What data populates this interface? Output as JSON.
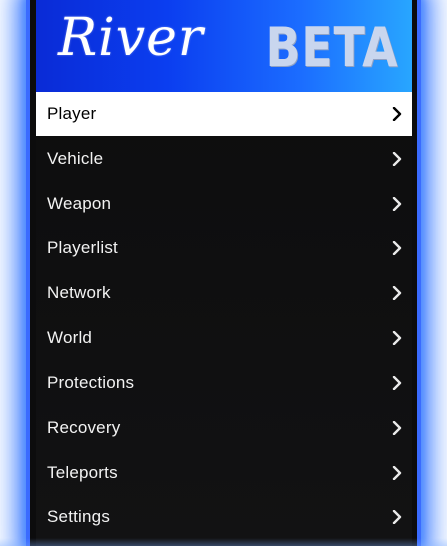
{
  "header": {
    "logo_text": "River",
    "badge_text": "BETA"
  },
  "menu": {
    "selected_index": 0,
    "items": [
      {
        "label": "Player",
        "icon": "chevron-right-icon"
      },
      {
        "label": "Vehicle",
        "icon": "chevron-right-icon"
      },
      {
        "label": "Weapon",
        "icon": "chevron-right-icon"
      },
      {
        "label": "Playerlist",
        "icon": "chevron-right-icon"
      },
      {
        "label": "Network",
        "icon": "chevron-right-icon"
      },
      {
        "label": "World",
        "icon": "chevron-right-icon"
      },
      {
        "label": "Protections",
        "icon": "chevron-right-icon"
      },
      {
        "label": "Recovery",
        "icon": "chevron-right-icon"
      },
      {
        "label": "Teleports",
        "icon": "chevron-right-icon"
      },
      {
        "label": "Settings",
        "icon": "chevron-right-icon"
      }
    ]
  },
  "colors": {
    "accent": "#0b3ef0",
    "glow": "#3a6bff",
    "menu_background": "#0d0d0e",
    "selected_background": "#ffffff"
  }
}
